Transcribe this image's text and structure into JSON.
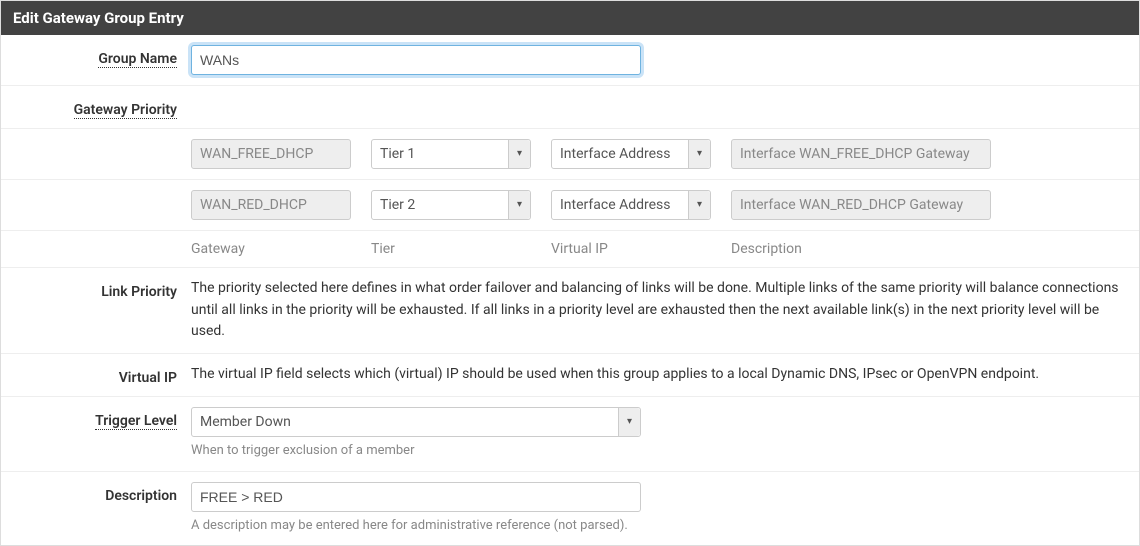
{
  "panel_title": "Edit Gateway Group Entry",
  "labels": {
    "group_name": "Group Name",
    "gateway_priority": "Gateway Priority",
    "link_priority": "Link Priority",
    "virtual_ip": "Virtual IP",
    "trigger_level": "Trigger Level",
    "description": "Description"
  },
  "group_name_value": "WANs",
  "gateway_rows": [
    {
      "name": "WAN_FREE_DHCP",
      "tier": "Tier 1",
      "vip": "Interface Address",
      "desc": "Interface WAN_FREE_DHCP Gateway"
    },
    {
      "name": "WAN_RED_DHCP",
      "tier": "Tier 2",
      "vip": "Interface Address",
      "desc": "Interface WAN_RED_DHCP Gateway"
    }
  ],
  "col_headers": {
    "gateway": "Gateway",
    "tier": "Tier",
    "vip": "Virtual IP",
    "desc": "Description"
  },
  "link_priority_text": "The priority selected here defines in what order failover and balancing of links will be done. Multiple links of the same priority will balance connections until all links in the priority will be exhausted. If all links in a priority level are exhausted then the next available link(s) in the next priority level will be used.",
  "virtual_ip_text": "The virtual IP field selects which (virtual) IP should be used when this group applies to a local Dynamic DNS, IPsec or OpenVPN endpoint.",
  "trigger_level_value": "Member Down",
  "trigger_level_help": "When to trigger exclusion of a member",
  "description_value": "FREE > RED",
  "description_help": "A description may be entered here for administrative reference (not parsed)."
}
